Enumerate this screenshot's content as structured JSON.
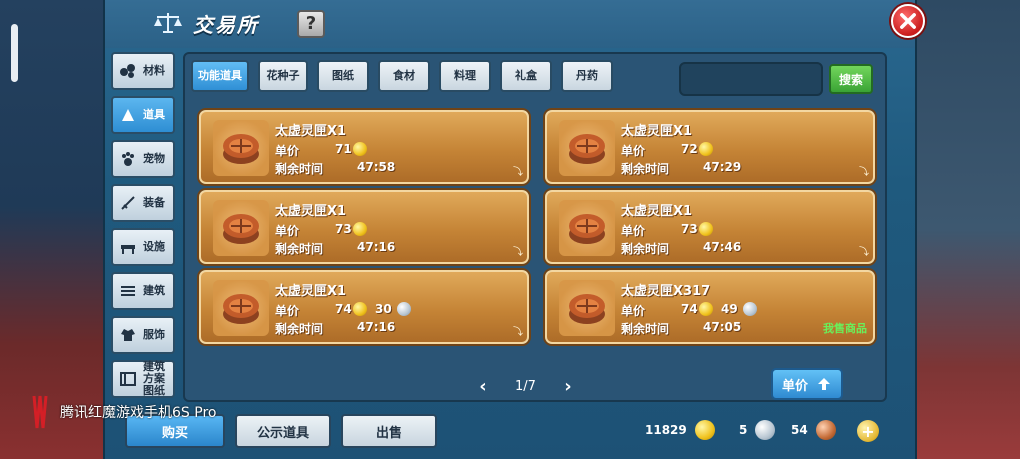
{
  "device_brand": "腾讯红魔游戏手机6S Pro",
  "header": {
    "title": "交易所",
    "help_label": "?"
  },
  "sidebar": [
    {
      "label": "材料",
      "icon": "materials-icon"
    },
    {
      "label": "道具",
      "icon": "items-icon",
      "active": true
    },
    {
      "label": "宠物",
      "icon": "pet-icon"
    },
    {
      "label": "装备",
      "icon": "equipment-icon"
    },
    {
      "label": "设施",
      "icon": "facility-icon"
    },
    {
      "label": "建筑",
      "icon": "building-icon"
    },
    {
      "label": "服饰",
      "icon": "clothing-icon"
    },
    {
      "label": "建筑方案图纸",
      "icon": "blueprint-icon"
    }
  ],
  "tabs": [
    {
      "label": "功能道具",
      "active": true
    },
    {
      "label": "花种子"
    },
    {
      "label": "图纸"
    },
    {
      "label": "食材"
    },
    {
      "label": "料理"
    },
    {
      "label": "礼盒"
    },
    {
      "label": "丹药"
    }
  ],
  "search": {
    "placeholder": "",
    "button_label": "搜索"
  },
  "labels": {
    "price": "单价",
    "remaining_time": "剩余时间"
  },
  "listings": [
    {
      "title": "太虚灵匣X1",
      "gold": "71",
      "silver": "",
      "time": "47:58",
      "tag": ""
    },
    {
      "title": "太虚灵匣X1",
      "gold": "72",
      "silver": "",
      "time": "47:29",
      "tag": ""
    },
    {
      "title": "太虚灵匣X1",
      "gold": "73",
      "silver": "",
      "time": "47:16",
      "tag": ""
    },
    {
      "title": "太虚灵匣X1",
      "gold": "73",
      "silver": "",
      "time": "47:46",
      "tag": ""
    },
    {
      "title": "太虚灵匣X1",
      "gold": "74",
      "silver": "30",
      "time": "47:16",
      "tag": ""
    },
    {
      "title": "太虚灵匣X317",
      "gold": "74",
      "silver": "49",
      "time": "47:05",
      "tag": "我售商品"
    }
  ],
  "pager": {
    "text": "1/7"
  },
  "sort_button": {
    "label": "单价"
  },
  "bottom": {
    "buy_label": "购买",
    "showcase_label": "公示道具",
    "sell_label": "出售"
  },
  "currency": {
    "gold": "11829",
    "silver": "5",
    "bronze": "54"
  },
  "colors": {
    "panel": "#2a6890",
    "card": "#d8963f",
    "accent": "#2f8fd5",
    "search": "#3aa335"
  }
}
